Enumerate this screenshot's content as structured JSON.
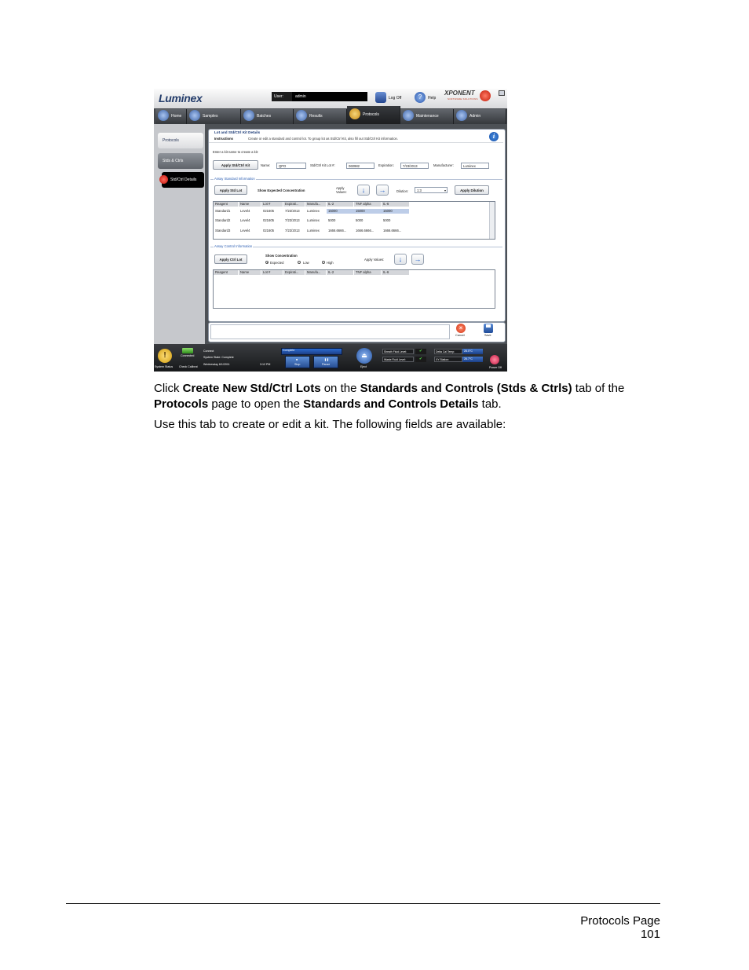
{
  "screenshot": {
    "logo": "Luminex",
    "user_label": "User:",
    "user_value": "admin",
    "log_off": "Log Off",
    "help": "Help",
    "brand": "XPONENT",
    "brand_sub": "SOFTWARE SOLUTIONS",
    "nav_tabs": [
      "Home",
      "Samples",
      "Batches",
      "Results",
      "Protocols",
      "Maintenance",
      "Admin"
    ],
    "active_tab": "Protocols",
    "side_tabs": [
      "Protocols",
      "Stds & Ctrls",
      "Std/Ctrl Details"
    ],
    "panel_title": "Lot and Std/Ctrl Kit Details",
    "instructions_label": "Instructions",
    "instructions_text": "Create or edit a standard and control lot.  To group lot as Std/Ctrl Kit, also fill out Std/Ctrl Kit information.",
    "kit_prompt": "Enter a kit name to create a kit:",
    "apply_kit_button": "Apply Std/Ctrl Kit",
    "name_label": "Name:",
    "name_value": "QPO",
    "lot_label": "Std/Ctrl Kit Lot #:",
    "lot_value": "060982",
    "expiration_label": "Expiration:",
    "expiration_value": "7/23/2013",
    "manufacturer_label": "Manufacturer:",
    "manufacturer_value": "Luminex",
    "assay_standard": {
      "section_label": "Assay Standard Information",
      "apply_lot_button": "Apply Std Lot",
      "show_expected": "Show Expected Concentration",
      "apply_values_label": "Apply Values:",
      "dilution_label": "Dilution:",
      "dilution_value": "1:3",
      "apply_dilution_button": "Apply Dilution",
      "columns": [
        "Reagent",
        "Name",
        "Lot #",
        "Expirati...",
        "Manufa...",
        "IL-2",
        "TNF alpha",
        "IL-6"
      ],
      "rows": [
        [
          "Standard1",
          "Level4",
          "021605",
          "7/23/2013",
          "Luminex",
          "15000",
          "15000",
          "15000"
        ],
        [
          "Standard2",
          "Level4",
          "021605",
          "7/23/2013",
          "Luminex",
          "5000",
          "5000",
          "5000"
        ],
        [
          "Standard3",
          "Level4",
          "021605",
          "7/23/2013",
          "Luminex",
          "1666.6666...",
          "1666.6666...",
          "1666.6666..."
        ]
      ]
    },
    "assay_control": {
      "section_label": "Assay Control Information",
      "apply_lot_button": "Apply Ctrl Lot",
      "show_concentration": "Show Concentration",
      "radio_expected": "Expected",
      "radio_low": "Low",
      "radio_high": "High",
      "apply_values_label": "Apply Values:",
      "columns": [
        "Reagent",
        "Name",
        "Lot #",
        "Expirati...",
        "Manufa...",
        "IL-2",
        "TNF alpha",
        "IL-6"
      ]
    },
    "cancel": "Cancel",
    "save": "Save",
    "status": {
      "system_status": "System Status",
      "connected": "Connected",
      "check_calibrator": "Check Calibrat",
      "line1": "Connect",
      "line2": "System State:  Complete",
      "date": "Wednesday 6/1/2011",
      "time": "3:12 PM",
      "progress_label": "Complete",
      "stop": "Stop",
      "pause": "Pause",
      "eject": "Eject",
      "sheath_fluid": "Sheath Fluid Level:",
      "waste_fluid": "Waste Fluid Level:",
      "delta_cal": "Delta Cal Temp:",
      "delta_cal_value": "26.0°C",
      "xy_station": "XY Station:",
      "xy_station_value": "26.7°C",
      "power_off": "Power Off"
    }
  },
  "paragraph1": {
    "t1": "Click ",
    "b1": "Create New Std/Ctrl Lots",
    "t2": " on the ",
    "b2": "Standards and Controls (Stds & Ctrls)",
    "t3": " tab of the ",
    "b3": "Protocols",
    "t4": " page to open the ",
    "b4": "Standards and Controls Details",
    "t5": " tab."
  },
  "paragraph2": "Use this tab to create or edit a kit. The following fields are available:",
  "footer": {
    "line1": "Protocols Page",
    "line2": "101"
  }
}
